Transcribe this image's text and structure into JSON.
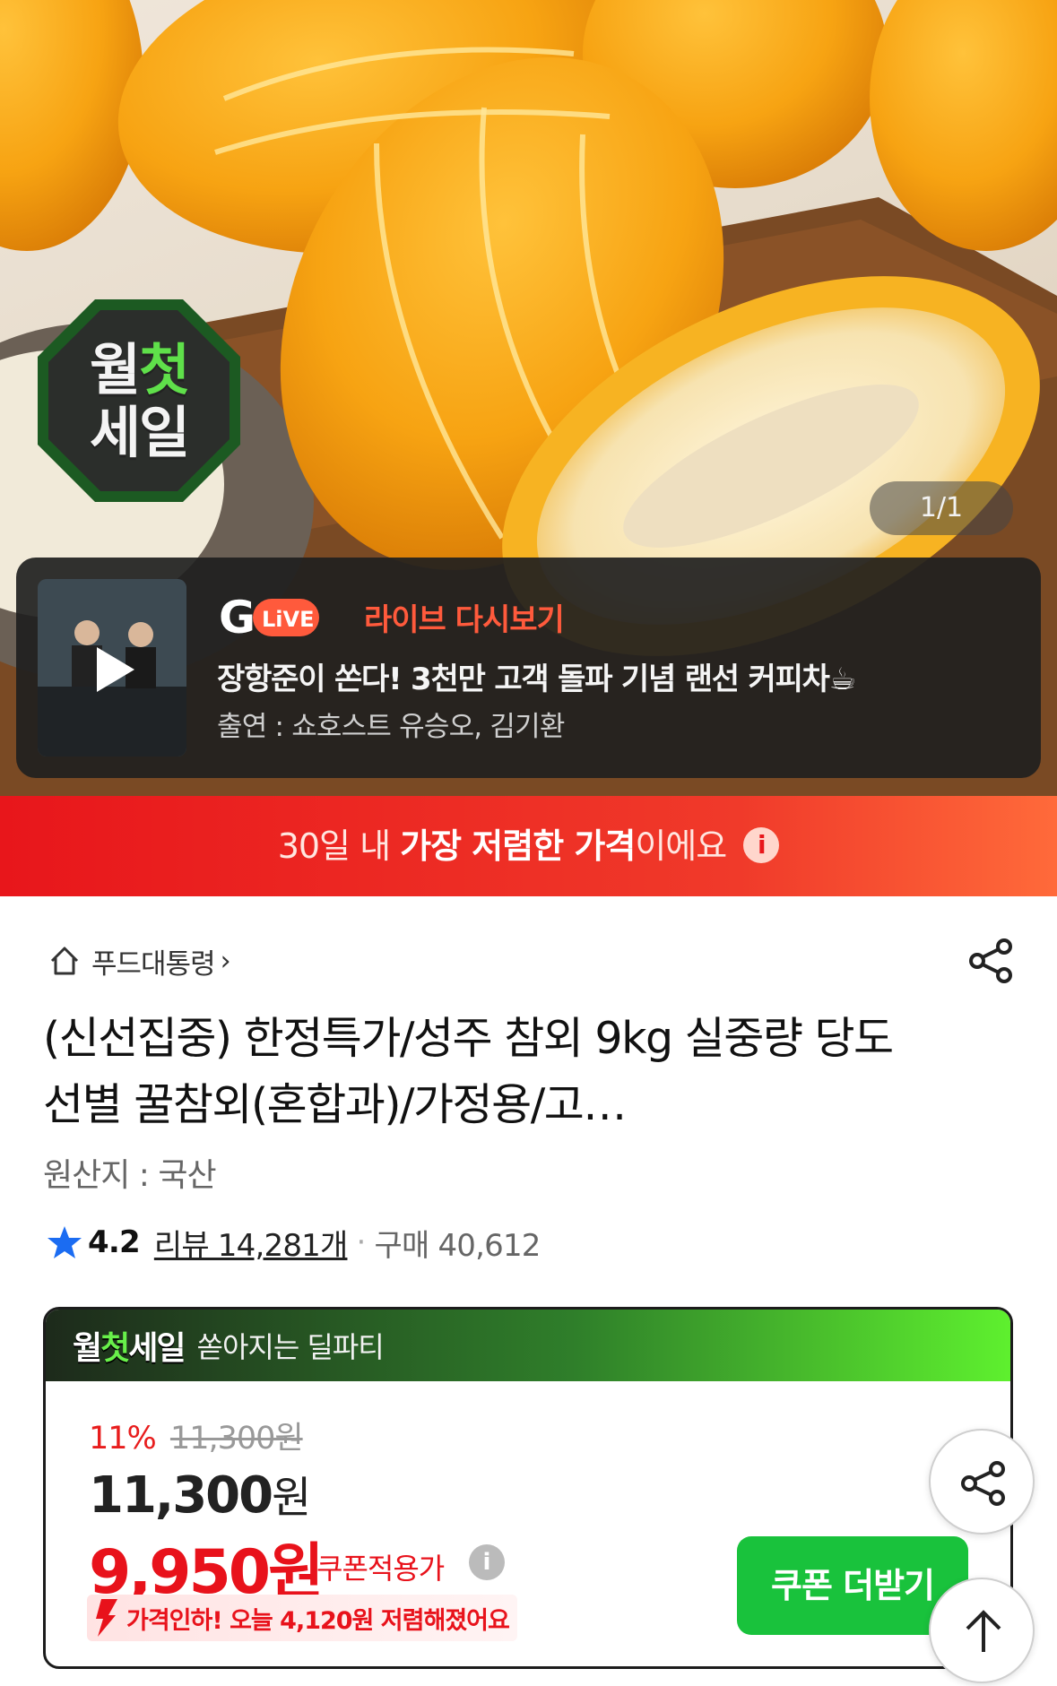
{
  "hero": {
    "badge_line1_a": "월",
    "badge_line1_b": "첫",
    "badge_line2": "세일",
    "page_counter": "1/1"
  },
  "live": {
    "logo_g": "G",
    "logo_live": "LiVE",
    "replay_label": "라이브 다시보기",
    "title": "장항준이 쏜다! 3천만 고객 돌파 기념 랜선 커피차☕",
    "cast": "출연 : 쇼호스트 유승오, 김기환"
  },
  "banner": {
    "prefix": "30일 내 ",
    "highlight": "가장 저렴한 가격",
    "suffix": "이에요",
    "info_glyph": "i"
  },
  "product": {
    "breadcrumb": "푸드대통령",
    "breadcrumb_chevron": "›",
    "title": "(신선집중) 한정특가/성주 참외 9kg 실중량 당도선별 꿀참외(혼합과)/가정용/고…",
    "origin": "원산지 : 국산",
    "rating": "4.2",
    "review": "리뷰 14,281개",
    "separator": "·",
    "purchase": "구매 40,612"
  },
  "deal": {
    "brand_a": "월",
    "brand_b": "첫",
    "brand_c": "세일",
    "subtitle": "쏟아지는 딜파티",
    "discount": "11%",
    "original_price": "11,300원",
    "price_number": "11,300",
    "price_unit": "원",
    "coupon_price": "9,950원",
    "coupon_label": "쿠폰적용가",
    "coupon_info_glyph": "i",
    "price_drop": "가격인하! 오늘 4,120원 저렴해졌어요",
    "coupon_button": "쿠폰 더받기"
  },
  "colors": {
    "accent_red": "#e8121b",
    "accent_green": "#19c23c",
    "live_orange": "#ff5a3c"
  },
  "icons": {
    "home": "home-icon",
    "share": "share-icon",
    "star": "star-icon",
    "play": "play-icon",
    "arrow_up": "arrow-up-icon",
    "price_drop": "arrow-down-icon"
  }
}
